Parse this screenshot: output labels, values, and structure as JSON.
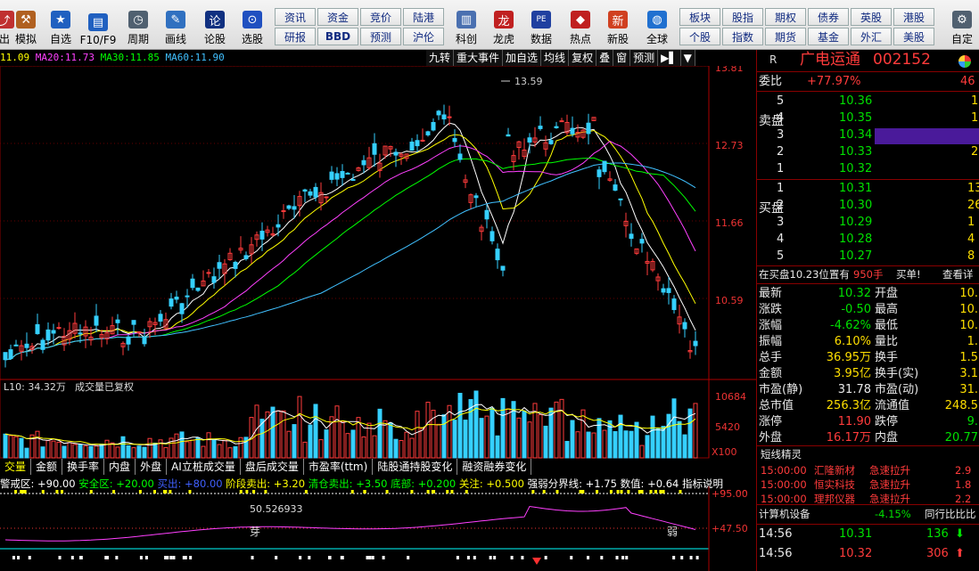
{
  "toolbar": {
    "big_buttons": [
      {
        "label": "出",
        "icon": "exit-icon",
        "color": "#c03030"
      },
      {
        "label": "模拟",
        "icon": "hammer-icon",
        "color": "#b06020"
      },
      {
        "label": "自选",
        "icon": "star-icon",
        "color": "#2060c0"
      },
      {
        "label": "F10/F9",
        "icon": "f10-icon",
        "color": "#2060c0"
      },
      {
        "label": "周期",
        "icon": "clock-icon",
        "color": "#506070"
      },
      {
        "label": "画线",
        "icon": "pen-icon",
        "color": "#3070c0"
      },
      {
        "label": "论股",
        "icon": "talk-icon",
        "color": "#103080"
      },
      {
        "label": "选股",
        "icon": "chart-pick-icon",
        "color": "#2050c0"
      }
    ],
    "row1": [
      "资讯",
      "资金",
      "竞价",
      "陆港"
    ],
    "row2": [
      "研报",
      "BBD",
      "预测",
      "沪伦"
    ],
    "mid_buttons": [
      {
        "label": "科创",
        "icon": "kechuang-icon",
        "color": "#4a70b0"
      },
      {
        "label": "龙虎",
        "icon": "dragon-icon",
        "color": "#c02020"
      },
      {
        "label": "数据",
        "icon": "pe-icon",
        "color": "#2040a0"
      },
      {
        "label": "热点",
        "icon": "hot-icon",
        "color": "#c02020"
      },
      {
        "label": "新股",
        "icon": "newstock-icon",
        "color": "#d04020"
      },
      {
        "label": "全球",
        "icon": "globe-icon",
        "color": "#2070d0"
      },
      {
        "label": "自定",
        "icon": "custom-icon",
        "color": "#506070"
      }
    ],
    "right_row1": [
      "板块",
      "股指",
      "期权",
      "债券",
      "英股",
      "港股"
    ],
    "right_row2": [
      "个股",
      "指数",
      "期货",
      "基金",
      "外汇",
      "美股"
    ]
  },
  "ma_bar": {
    "ma10": "11.09",
    "ma20_label": "MA20:",
    "ma20": "11.73",
    "ma30_label": "MA30:",
    "ma30": "11.85",
    "ma60_label": "MA60:",
    "ma60": "11.90",
    "colors": {
      "ma10": "#ffff00",
      "ma20": "#ff40ff",
      "ma30": "#00ff00",
      "ma60": "#40c0ff"
    }
  },
  "chart_tools": [
    "九转",
    "重大事件",
    "加自选",
    "均线",
    "复权",
    "叠",
    "窗",
    "预测",
    "▶▌",
    "▼"
  ],
  "price_axis": {
    "p1": "13.81",
    "p2": "12.73",
    "p3": "11.66",
    "p4": "10.59",
    "max_marker": "13.59"
  },
  "volume": {
    "label": "L10: 34.32万",
    "note": "成交量已复权",
    "v1": "10684",
    "v2": "5420",
    "unit": "X100"
  },
  "indicator_tabs": [
    "交量",
    "金额",
    "换手率",
    "内盘",
    "外盘",
    "AI立桩成交量",
    "盘后成交量",
    "市盈率(ttm)",
    "陆股通持股变化",
    "融资融券变化"
  ],
  "indicator_bar": {
    "warn": "警戒区: +90.00",
    "safe": "安全区: +20.00",
    "buy": "买出: +80.00",
    "stage": "阶段卖出: +3.20",
    "clear": "清仓卖出: +3.50",
    "bottom": "底部: +0.200",
    "watch": "关注: +0.500",
    "strong": "强弱分界线: +1.75",
    "value": "数值: +0.64",
    "explain": "指标说明"
  },
  "indicator": {
    "y1": "+95.00",
    "y2": "+47.50",
    "val": "50.526933",
    "ya": "芽",
    "ruo": "弱"
  },
  "quote": {
    "r": "R",
    "name": "广电运通",
    "code": "002152",
    "weibi_label": "委比",
    "weibi": "+77.97%",
    "weicha": "46",
    "sell_label": "卖盘",
    "buy_label": "买盘",
    "sell": [
      {
        "lvl": "5",
        "price": "10.36",
        "vol": "1"
      },
      {
        "lvl": "4",
        "price": "10.35",
        "vol": "1"
      },
      {
        "lvl": "3",
        "price": "10.34",
        "vol": ""
      },
      {
        "lvl": "2",
        "price": "10.33",
        "vol": "2"
      },
      {
        "lvl": "1",
        "price": "10.32",
        "vol": ""
      }
    ],
    "buy": [
      {
        "lvl": "1",
        "price": "10.31",
        "vol": "13"
      },
      {
        "lvl": "2",
        "price": "10.30",
        "vol": "26"
      },
      {
        "lvl": "3",
        "price": "10.29",
        "vol": "1"
      },
      {
        "lvl": "4",
        "price": "10.28",
        "vol": "4"
      },
      {
        "lvl": "5",
        "price": "10.27",
        "vol": "8"
      }
    ],
    "notice_a": "在买盘10.23位置有",
    "notice_b": "950手",
    "notice_c": "买单!",
    "notice_d": "查看详",
    "stats": [
      {
        "l1": "最新",
        "v1": "10.32",
        "c1": "green",
        "l2": "开盘",
        "v2": "10."
      },
      {
        "l1": "涨跌",
        "v1": "-0.50",
        "c1": "green",
        "l2": "最高",
        "v2": "10."
      },
      {
        "l1": "涨幅",
        "v1": "-4.62%",
        "c1": "green",
        "l2": "最低",
        "v2": "10."
      },
      {
        "l1": "振幅",
        "v1": "6.10%",
        "c1": "yellow",
        "l2": "量比",
        "v2": "1."
      },
      {
        "l1": "总手",
        "v1": "36.95万",
        "c1": "yellow",
        "l2": "换手",
        "v2": "1.5"
      },
      {
        "l1": "金额",
        "v1": "3.95亿",
        "c1": "yellow",
        "l2": "换手(实)",
        "v2": "3.1"
      },
      {
        "l1": "市盈(静)",
        "v1": "31.78",
        "c1": "white",
        "l2": "市盈(动)",
        "v2": "31."
      },
      {
        "l1": "总市值",
        "v1": "256.3亿",
        "c1": "yellow",
        "l2": "流通值",
        "v2": "248.5"
      },
      {
        "l1": "涨停",
        "v1": "11.90",
        "c1": "red",
        "l2": "跌停",
        "v2": "9."
      },
      {
        "l1": "外盘",
        "v1": "16.17万",
        "c1": "red",
        "l2": "内盘",
        "v2": "20.77"
      }
    ],
    "short_title": "短线精灵",
    "short_list": [
      {
        "time": "15:00:00",
        "name": "汇隆新材",
        "event": "急速拉升",
        "val": "2.9"
      },
      {
        "time": "15:00:00",
        "name": "恒实科技",
        "event": "急速拉升",
        "val": "1.8"
      },
      {
        "time": "15:00:00",
        "name": "理邦仪器",
        "event": "急速拉升",
        "val": "2.2"
      }
    ],
    "sector": "计算机设备",
    "sector_chg": "-4.15%",
    "sector_compare": "同行比比比",
    "ticks": [
      {
        "time": "14:56",
        "price": "10.31",
        "vol": "136",
        "dir": "down"
      },
      {
        "time": "14:56",
        "price": "10.32",
        "vol": "306",
        "dir": "up"
      }
    ]
  }
}
